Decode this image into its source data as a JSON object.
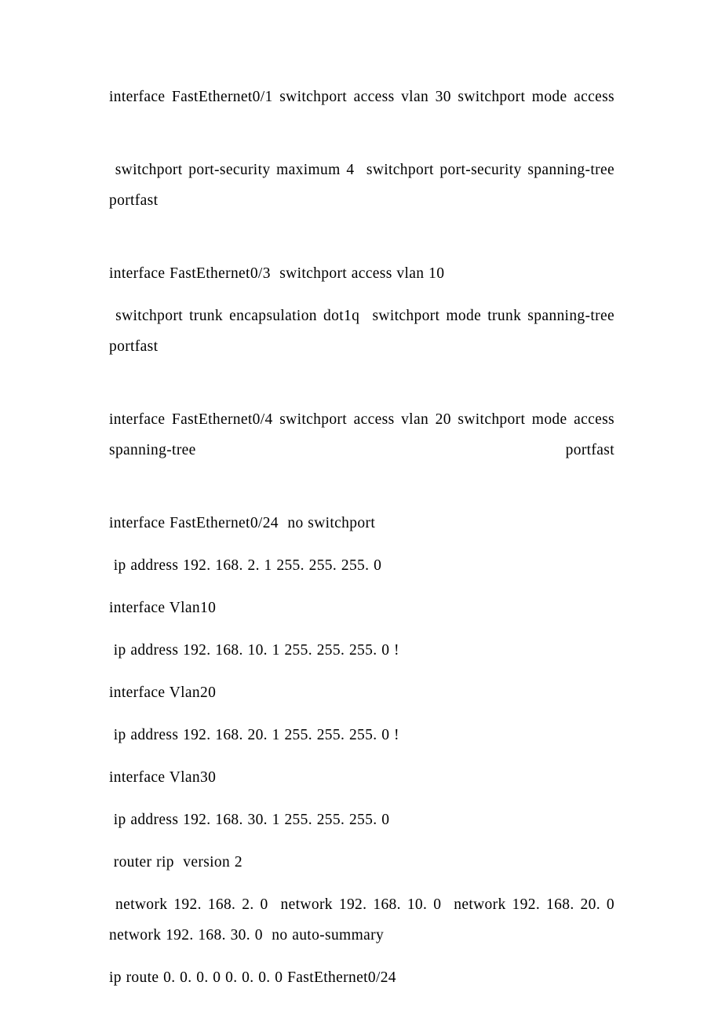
{
  "document": {
    "page_background": "#ffffff",
    "text_color": "#000000",
    "blocks": [
      {
        "id": "fa0-1-block",
        "name": "interface-fastethernet0-1-block",
        "justify_last_line": true,
        "text": "interface FastEthernet0/1 switchport access vlan 30 switchport mode access"
      },
      {
        "id": "port-security-block",
        "name": "port-security-block",
        "justify_last_line": true,
        "text": " switchport port-security maximum 4  switchport port-security spanning-tree portfast"
      },
      {
        "id": "fa0-3-block",
        "name": "interface-fastethernet0-3-block",
        "justify_last_line": false,
        "text": "interface FastEthernet0/3  switchport access vlan 10"
      },
      {
        "id": "trunk-block",
        "name": "switchport-trunk-block",
        "justify_last_line": true,
        "text": " switchport trunk encapsulation dot1q  switchport mode trunk spanning-tree portfast"
      },
      {
        "id": "fa0-4-block",
        "name": "interface-fastethernet0-4-block",
        "justify_last_line": true,
        "text": "interface FastEthernet0/4 switchport access vlan 20 switchport mode access  spanning-tree portfast"
      },
      {
        "id": "fa0-24-block",
        "name": "interface-fastethernet0-24-block",
        "justify_last_line": false,
        "text": "interface FastEthernet0/24  no switchport"
      },
      {
        "id": "ip-address-2-1-block",
        "name": "ip-address-192-168-2-1-block",
        "justify_last_line": false,
        "text": " ip address 192. 168. 2. 1 255. 255. 255. 0"
      },
      {
        "id": "vlan10-block",
        "name": "interface-vlan10-block",
        "justify_last_line": false,
        "text": "interface Vlan10"
      },
      {
        "id": "ip-address-10-1-block",
        "name": "ip-address-192-168-10-1-block",
        "justify_last_line": false,
        "text": " ip address 192. 168. 10. 1 255. 255. 255. 0 !"
      },
      {
        "id": "vlan20-block",
        "name": "interface-vlan20-block",
        "justify_last_line": false,
        "text": "interface Vlan20"
      },
      {
        "id": "ip-address-20-1-block",
        "name": "ip-address-192-168-20-1-block",
        "justify_last_line": false,
        "text": " ip address 192. 168. 20. 1 255. 255. 255. 0 !"
      },
      {
        "id": "vlan30-block",
        "name": "interface-vlan30-block",
        "justify_last_line": false,
        "text": "interface Vlan30"
      },
      {
        "id": "ip-address-30-1-block",
        "name": "ip-address-192-168-30-1-block",
        "justify_last_line": false,
        "text": " ip address 192. 168. 30. 1 255. 255. 255. 0"
      },
      {
        "id": "router-rip-block",
        "name": "router-rip-block",
        "justify_last_line": false,
        "text": " router rip  version 2"
      },
      {
        "id": "network-statements-block",
        "name": "rip-network-statements-block",
        "justify_last_line": false,
        "text": " network 192. 168. 2. 0  network 192. 168. 10. 0  network 192. 168. 20. 0  network 192. 168. 30. 0  no auto-summary"
      },
      {
        "id": "ip-route-block",
        "name": "static-default-route-block",
        "justify_last_line": false,
        "text": "ip route 0. 0. 0. 0 0. 0. 0. 0 FastEthernet0/24"
      }
    ]
  }
}
